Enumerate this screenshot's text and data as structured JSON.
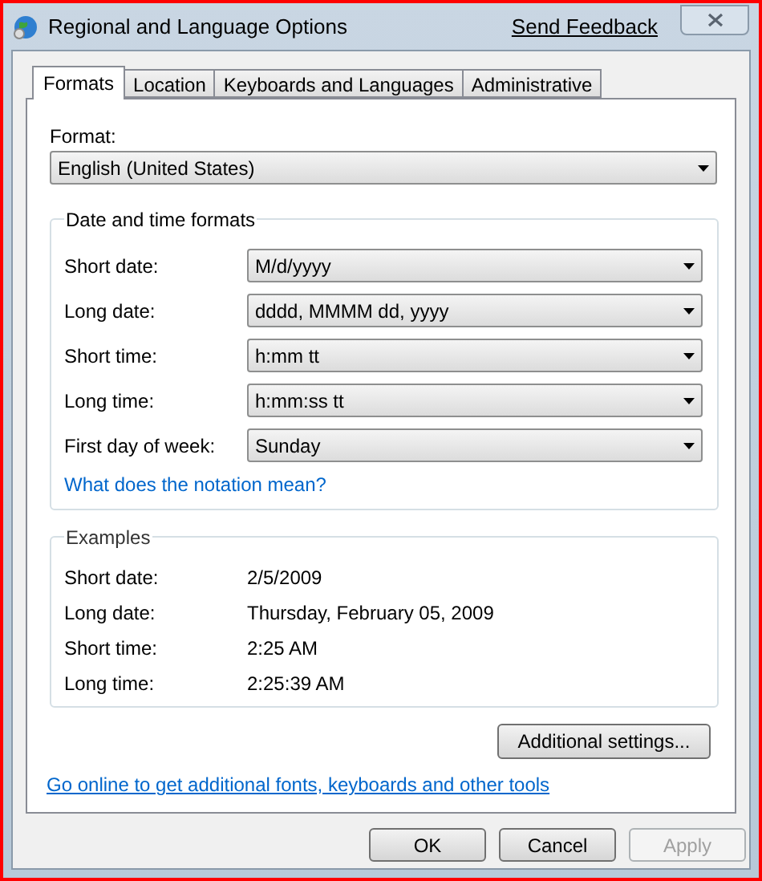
{
  "window": {
    "title": "Regional and Language Options",
    "feedback_link": "Send Feedback"
  },
  "tabs": [
    {
      "label": "Formats",
      "selected": true
    },
    {
      "label": "Location",
      "selected": false
    },
    {
      "label": "Keyboards and Languages",
      "selected": false
    },
    {
      "label": "Administrative",
      "selected": false
    }
  ],
  "format": {
    "label": "Format:",
    "value": "English (United States)"
  },
  "date_time_formats": {
    "title": "Date and time formats",
    "rows": [
      {
        "label": "Short date:",
        "value": "M/d/yyyy"
      },
      {
        "label": "Long date:",
        "value": "dddd, MMMM dd, yyyy"
      },
      {
        "label": "Short time:",
        "value": "h:mm tt"
      },
      {
        "label": "Long time:",
        "value": "h:mm:ss tt"
      },
      {
        "label": "First day of week:",
        "value": "Sunday"
      }
    ],
    "link": "What does the notation mean?"
  },
  "examples": {
    "title": "Examples",
    "rows": [
      {
        "label": "Short date:",
        "value": "2/5/2009"
      },
      {
        "label": "Long date:",
        "value": "Thursday, February 05, 2009"
      },
      {
        "label": "Short time:",
        "value": "2:25 AM"
      },
      {
        "label": "Long time:",
        "value": "2:25:39 AM"
      }
    ]
  },
  "additional_button": "Additional settings...",
  "online_link": "Go online to get additional fonts, keyboards and other tools",
  "buttons": [
    {
      "label": "OK",
      "disabled": false
    },
    {
      "label": "Cancel",
      "disabled": false
    },
    {
      "label": "Apply",
      "disabled": true
    }
  ]
}
